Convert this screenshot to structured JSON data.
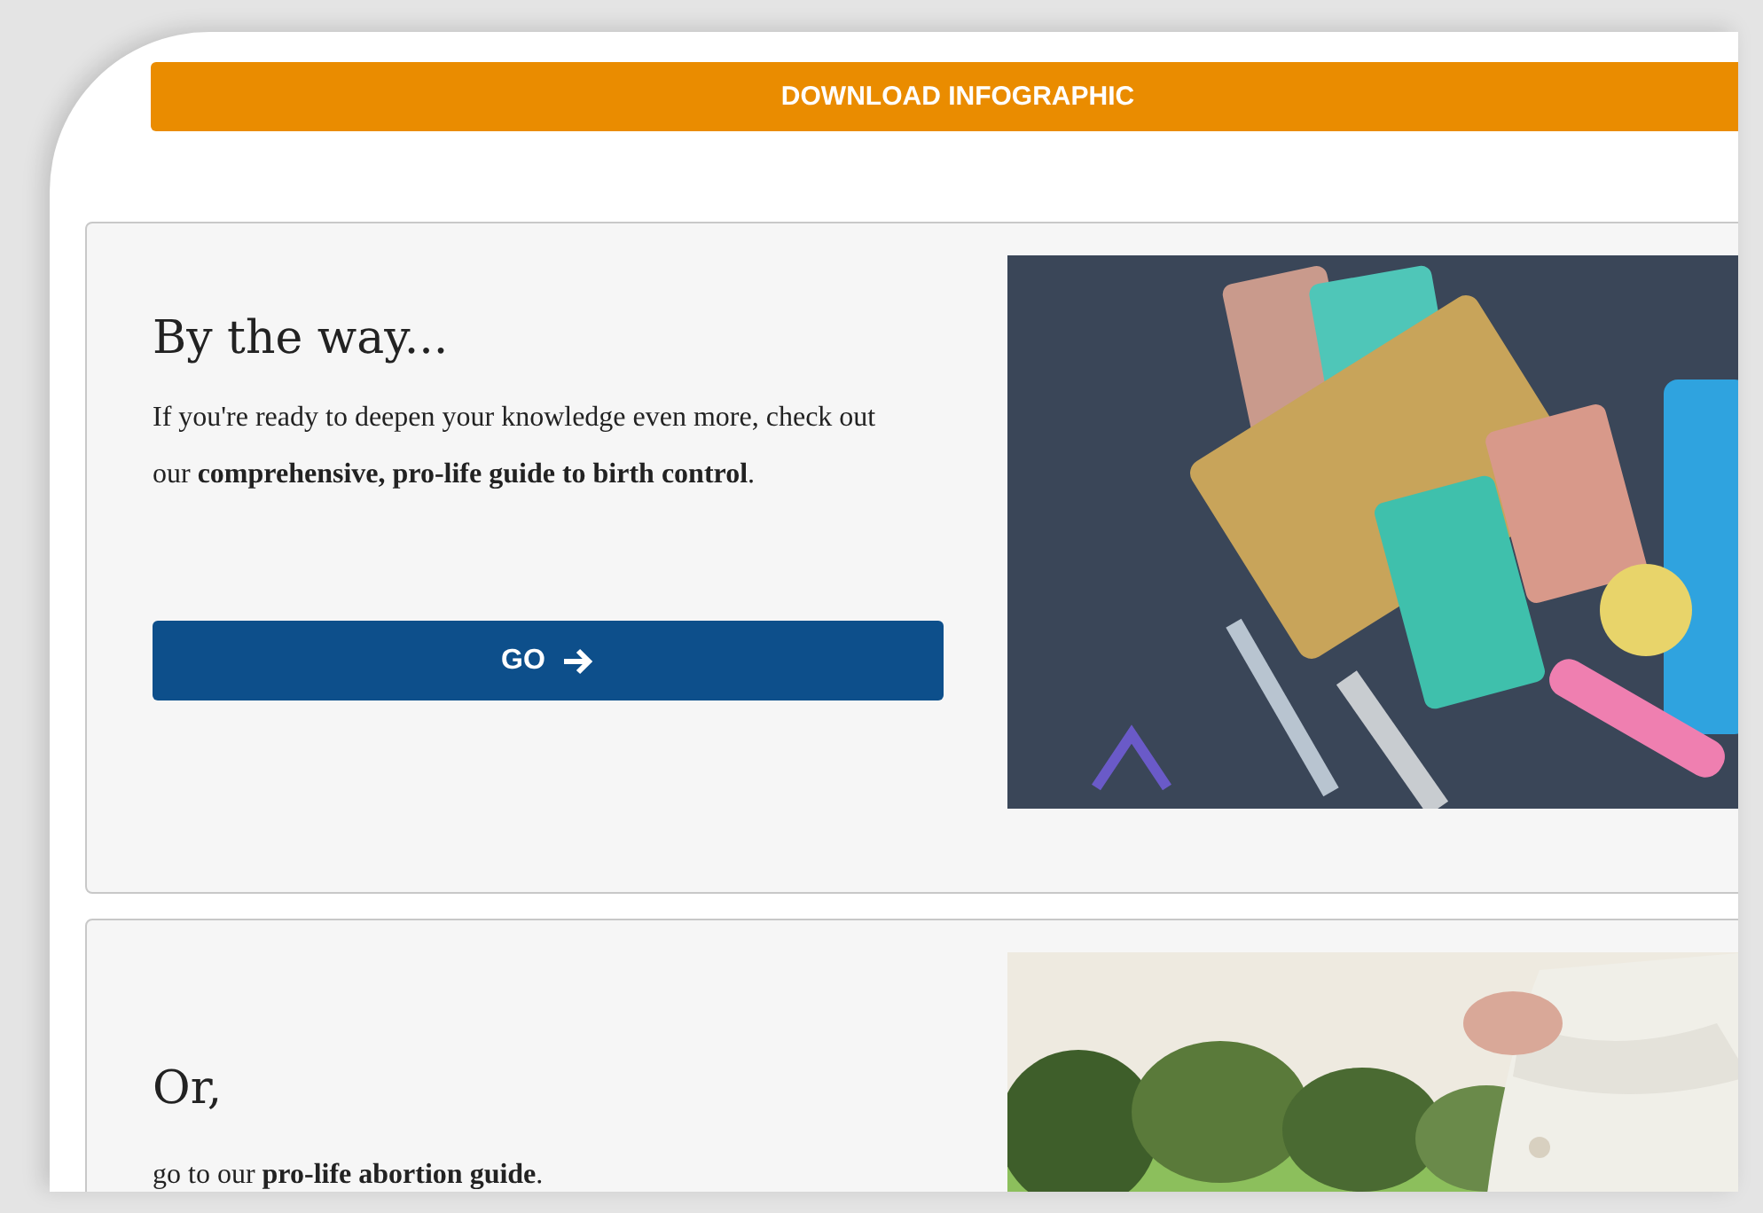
{
  "download_button": {
    "label": "DOWNLOAD INFOGRAPHIC"
  },
  "cards": [
    {
      "title": "By the way...",
      "text": "If you're ready to deepen your knowledge even more, check out our **comprehensive, pro-life guide to birth control**.",
      "button": {
        "label": "GO"
      }
    },
    {
      "title": "Or,",
      "text": "go to our **pro-life abortion guide**."
    }
  ]
}
